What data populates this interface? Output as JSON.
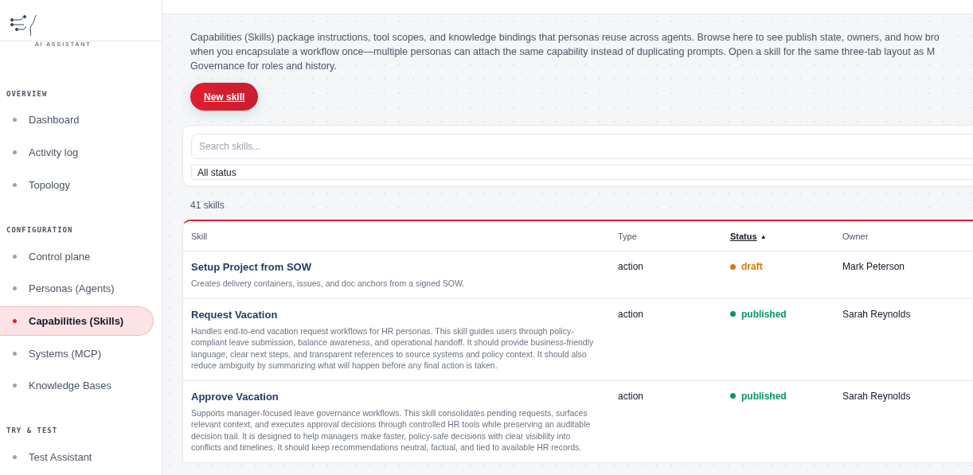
{
  "sidebar": {
    "logo_tagline": "AI ASSISTANT",
    "sections": [
      {
        "title": "OVERVIEW",
        "items": [
          {
            "label": "Dashboard",
            "selected": false
          },
          {
            "label": "Activity log",
            "selected": false
          },
          {
            "label": "Topology",
            "selected": false
          }
        ]
      },
      {
        "title": "CONFIGURATION",
        "items": [
          {
            "label": "Control plane",
            "selected": false
          },
          {
            "label": "Personas (Agents)",
            "selected": false
          },
          {
            "label": "Capabilities (Skills)",
            "selected": true
          },
          {
            "label": "Systems (MCP)",
            "selected": false
          },
          {
            "label": "Knowledge Bases",
            "selected": false
          }
        ]
      },
      {
        "title": "TRY & TEST",
        "items": [
          {
            "label": "Test Assistant",
            "selected": false
          }
        ]
      }
    ]
  },
  "intro_lines": [
    "Capabilities (Skills) package instructions, tool scopes, and knowledge bindings that personas reuse across agents. Browse here to see publish state, owners, and how bro",
    "when you encapsulate a workflow once—multiple personas can attach the same capability instead of duplicating prompts. Open a skill for the same three-tab layout as M",
    "Governance for roles and history."
  ],
  "new_button": "New skill",
  "filters": {
    "search": {
      "placeholder": "Search skills..."
    },
    "status_select": "All status"
  },
  "count": "41 skills",
  "table": {
    "columns": [
      {
        "label": "Skill",
        "sorted": false
      },
      {
        "label": "Type",
        "sorted": false
      },
      {
        "label": "Status",
        "sorted": true,
        "sort_icon": "▲"
      },
      {
        "label": "Owner",
        "sorted": false
      }
    ],
    "rows": [
      {
        "name": "Setup Project from SOW",
        "description": "Creates delivery containers, issues, and doc anchors from a signed SOW.",
        "type": "action",
        "status": "draft",
        "color": "#d97706",
        "owner": "Mark Peterson"
      },
      {
        "name": "Request Vacation",
        "description": "Handles end-to-end vacation request workflows for HR personas. This skill guides users through policy-compliant leave submission, balance awareness, and operational handoff. It should provide business-friendly language, clear next steps, and transparent references to source systems and policy context. It should also reduce ambiguity by summarizing what will happen before any final action is taken.",
        "type": "action",
        "status": "published",
        "color": "#059669",
        "owner": "Sarah Reynolds"
      },
      {
        "name": "Approve Vacation",
        "description": "Supports manager-focused leave governance workflows. This skill consolidates pending requests, surfaces relevant context, and executes approval decisions through controlled HR tools while preserving an auditable decision trail. It is designed to help managers make faster, policy-safe decisions with clear visibility into conflicts and timelines. It should keep recommendations neutral, factual, and tied to available HR records.",
        "type": "action",
        "status": "published",
        "color": "#059669",
        "owner": "Sarah Reynolds"
      }
    ]
  }
}
